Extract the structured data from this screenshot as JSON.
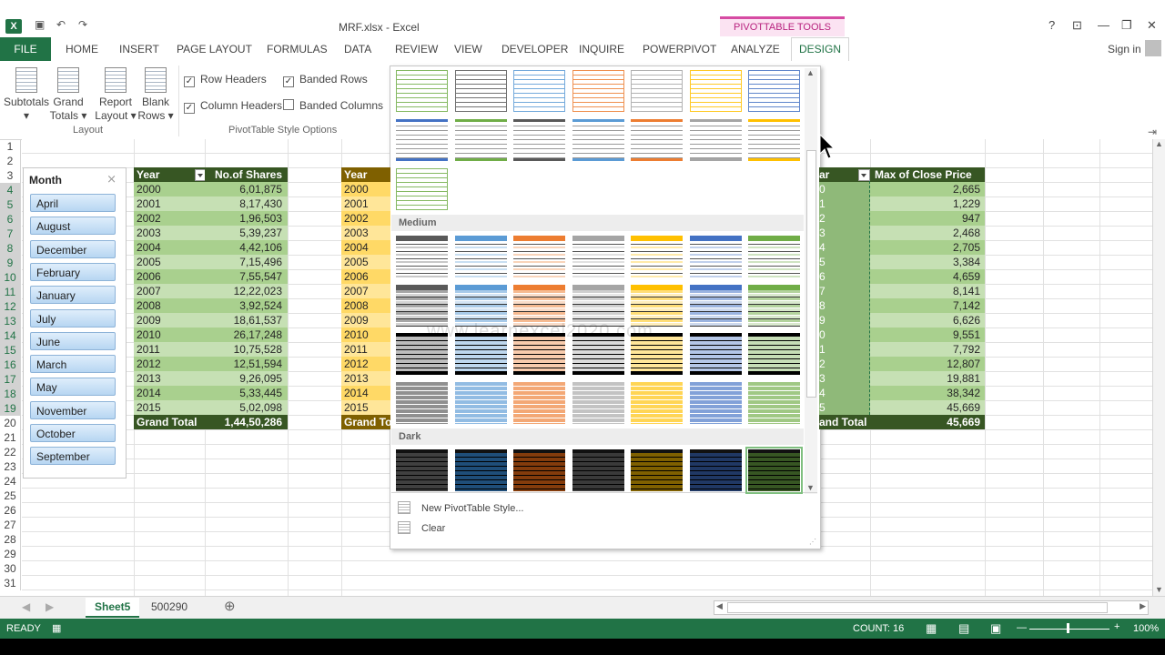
{
  "titlebar": {
    "app_icon": "X",
    "title": "MRF.xlsx - Excel",
    "context_tab": "PIVOTTABLE TOOLS",
    "help": "?",
    "min": "—",
    "max": "❐",
    "close": "✕"
  },
  "tabs": [
    "FILE",
    "HOME",
    "INSERT",
    "PAGE LAYOUT",
    "FORMULAS",
    "DATA",
    "REVIEW",
    "VIEW",
    "DEVELOPER",
    "INQUIRE",
    "POWERPIVOT",
    "ANALYZE",
    "DESIGN"
  ],
  "account": {
    "signin": "Sign in"
  },
  "ribbon": {
    "subtotals": "Subtotals",
    "grand_totals_1": "Grand",
    "grand_totals_2": "Totals",
    "report_layout_1": "Report",
    "report_layout_2": "Layout",
    "blank_rows_1": "Blank",
    "blank_rows_2": "Rows",
    "group_layout": "Layout",
    "row_headers": "Row Headers",
    "column_headers": "Column Headers",
    "banded_rows": "Banded Rows",
    "banded_columns": "Banded Columns",
    "group_style_options": "PivotTable Style Options",
    "checked_mark": "✓"
  },
  "rows": [
    "1",
    "2",
    "3",
    "4",
    "5",
    "6",
    "7",
    "8",
    "9",
    "10",
    "11",
    "12",
    "13",
    "14",
    "15",
    "16",
    "17",
    "18",
    "19",
    "20",
    "21",
    "22",
    "23",
    "24",
    "25",
    "26",
    "27",
    "28",
    "29",
    "30",
    "31"
  ],
  "slicer": {
    "title": "Month",
    "items": [
      "April",
      "August",
      "December",
      "February",
      "January",
      "July",
      "June",
      "March",
      "May",
      "November",
      "October",
      "September"
    ]
  },
  "pivot1": {
    "col_year": "Year",
    "col_value": "No.of Shares",
    "rows": [
      [
        "2000",
        "6,01,875"
      ],
      [
        "2001",
        "8,17,430"
      ],
      [
        "2002",
        "1,96,503"
      ],
      [
        "2003",
        "5,39,237"
      ],
      [
        "2004",
        "4,42,106"
      ],
      [
        "2005",
        "7,15,496"
      ],
      [
        "2006",
        "7,55,547"
      ],
      [
        "2007",
        "12,22,023"
      ],
      [
        "2008",
        "3,92,524"
      ],
      [
        "2009",
        "18,61,537"
      ],
      [
        "2010",
        "26,17,248"
      ],
      [
        "2011",
        "10,75,528"
      ],
      [
        "2012",
        "12,51,594"
      ],
      [
        "2013",
        "9,26,095"
      ],
      [
        "2014",
        "5,33,445"
      ],
      [
        "2015",
        "5,02,098"
      ]
    ],
    "total_label": "Grand Total",
    "total_value": "1,44,50,286"
  },
  "pivot2": {
    "col_year": "Year",
    "rows": [
      "2000",
      "2001",
      "2002",
      "2003",
      "2004",
      "2005",
      "2006",
      "2007",
      "2008",
      "2009",
      "2010",
      "2011",
      "2012",
      "2013",
      "2014",
      "2015"
    ],
    "total_label": "Grand To"
  },
  "pivot3": {
    "col_year": "ar",
    "col_value": "Max of Close Price",
    "year_digits": [
      "0",
      "1",
      "2",
      "3",
      "4",
      "5",
      "6",
      "7",
      "8",
      "9",
      "0",
      "1",
      "2",
      "3",
      "4",
      "5"
    ],
    "values": [
      "2,665",
      "1,229",
      "947",
      "2,468",
      "2,705",
      "3,384",
      "4,659",
      "8,141",
      "7,142",
      "6,626",
      "9,551",
      "7,792",
      "12,807",
      "19,881",
      "38,342",
      "45,669"
    ],
    "total_label": "and Total",
    "total_value": "45,669"
  },
  "gallery": {
    "section_medium": "Medium",
    "section_dark": "Dark",
    "watermark": "www.learnexcel2020.com",
    "new_style": "New PivotTable Style...",
    "clear": "Clear",
    "light_colors": [
      "#70ad47",
      "#595959",
      "#5b9bd5",
      "#ed7d31",
      "#a5a5a5",
      "#ffc000",
      "#4472c4"
    ],
    "medium_colors": [
      "#595959",
      "#5b9bd5",
      "#ed7d31",
      "#a5a5a5",
      "#ffc000",
      "#4472c4",
      "#70ad47"
    ],
    "dark_colors": [
      "#404040",
      "#1f4e79",
      "#843c0c",
      "#3a3a3a",
      "#7f6000",
      "#203864",
      "#375623"
    ]
  },
  "sheets": {
    "tab1": "Sheet5",
    "tab2": "500290",
    "add": "⊕"
  },
  "status": {
    "ready": "READY",
    "count": "COUNT: 16",
    "zoom": "100%",
    "minus": "—",
    "plus": "+"
  },
  "colors": {
    "excel_green": "#217346",
    "pivot_green": "#375623",
    "pivot_gold": "#7f6000",
    "context_pink": "#d64ba3"
  }
}
